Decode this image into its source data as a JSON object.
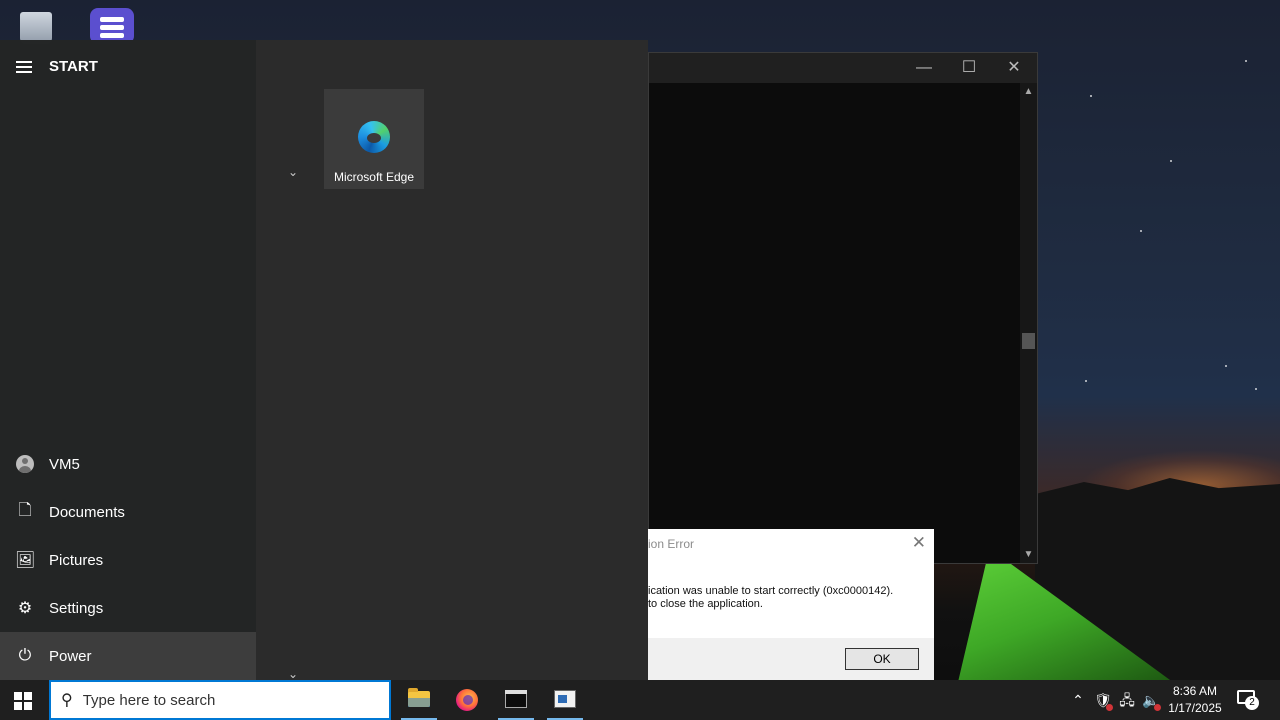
{
  "start_menu": {
    "title": "START",
    "user": "VM5",
    "items": [
      {
        "label": "Documents",
        "icon": "document-icon"
      },
      {
        "label": "Pictures",
        "icon": "pictures-icon"
      },
      {
        "label": "Settings",
        "icon": "gear-icon"
      },
      {
        "label": "Power",
        "icon": "power-icon"
      }
    ],
    "tiles": [
      {
        "label": "Microsoft Edge",
        "icon": "edge-icon"
      }
    ]
  },
  "console_window": {
    "controls": {
      "minimize": "—",
      "maximize": "☐",
      "close": "✕"
    }
  },
  "error_dialog": {
    "title": "ion Error",
    "message_line1": "ication was unable to start correctly (0xc0000142).",
    "message_line2": "to close the application.",
    "ok_label": "OK",
    "close": "✕"
  },
  "taskbar": {
    "search_placeholder": "Type here to search",
    "clock_time": "8:36 AM",
    "clock_date": "1/17/2025",
    "notification_count": "2",
    "accent_color": "#0078d4"
  }
}
